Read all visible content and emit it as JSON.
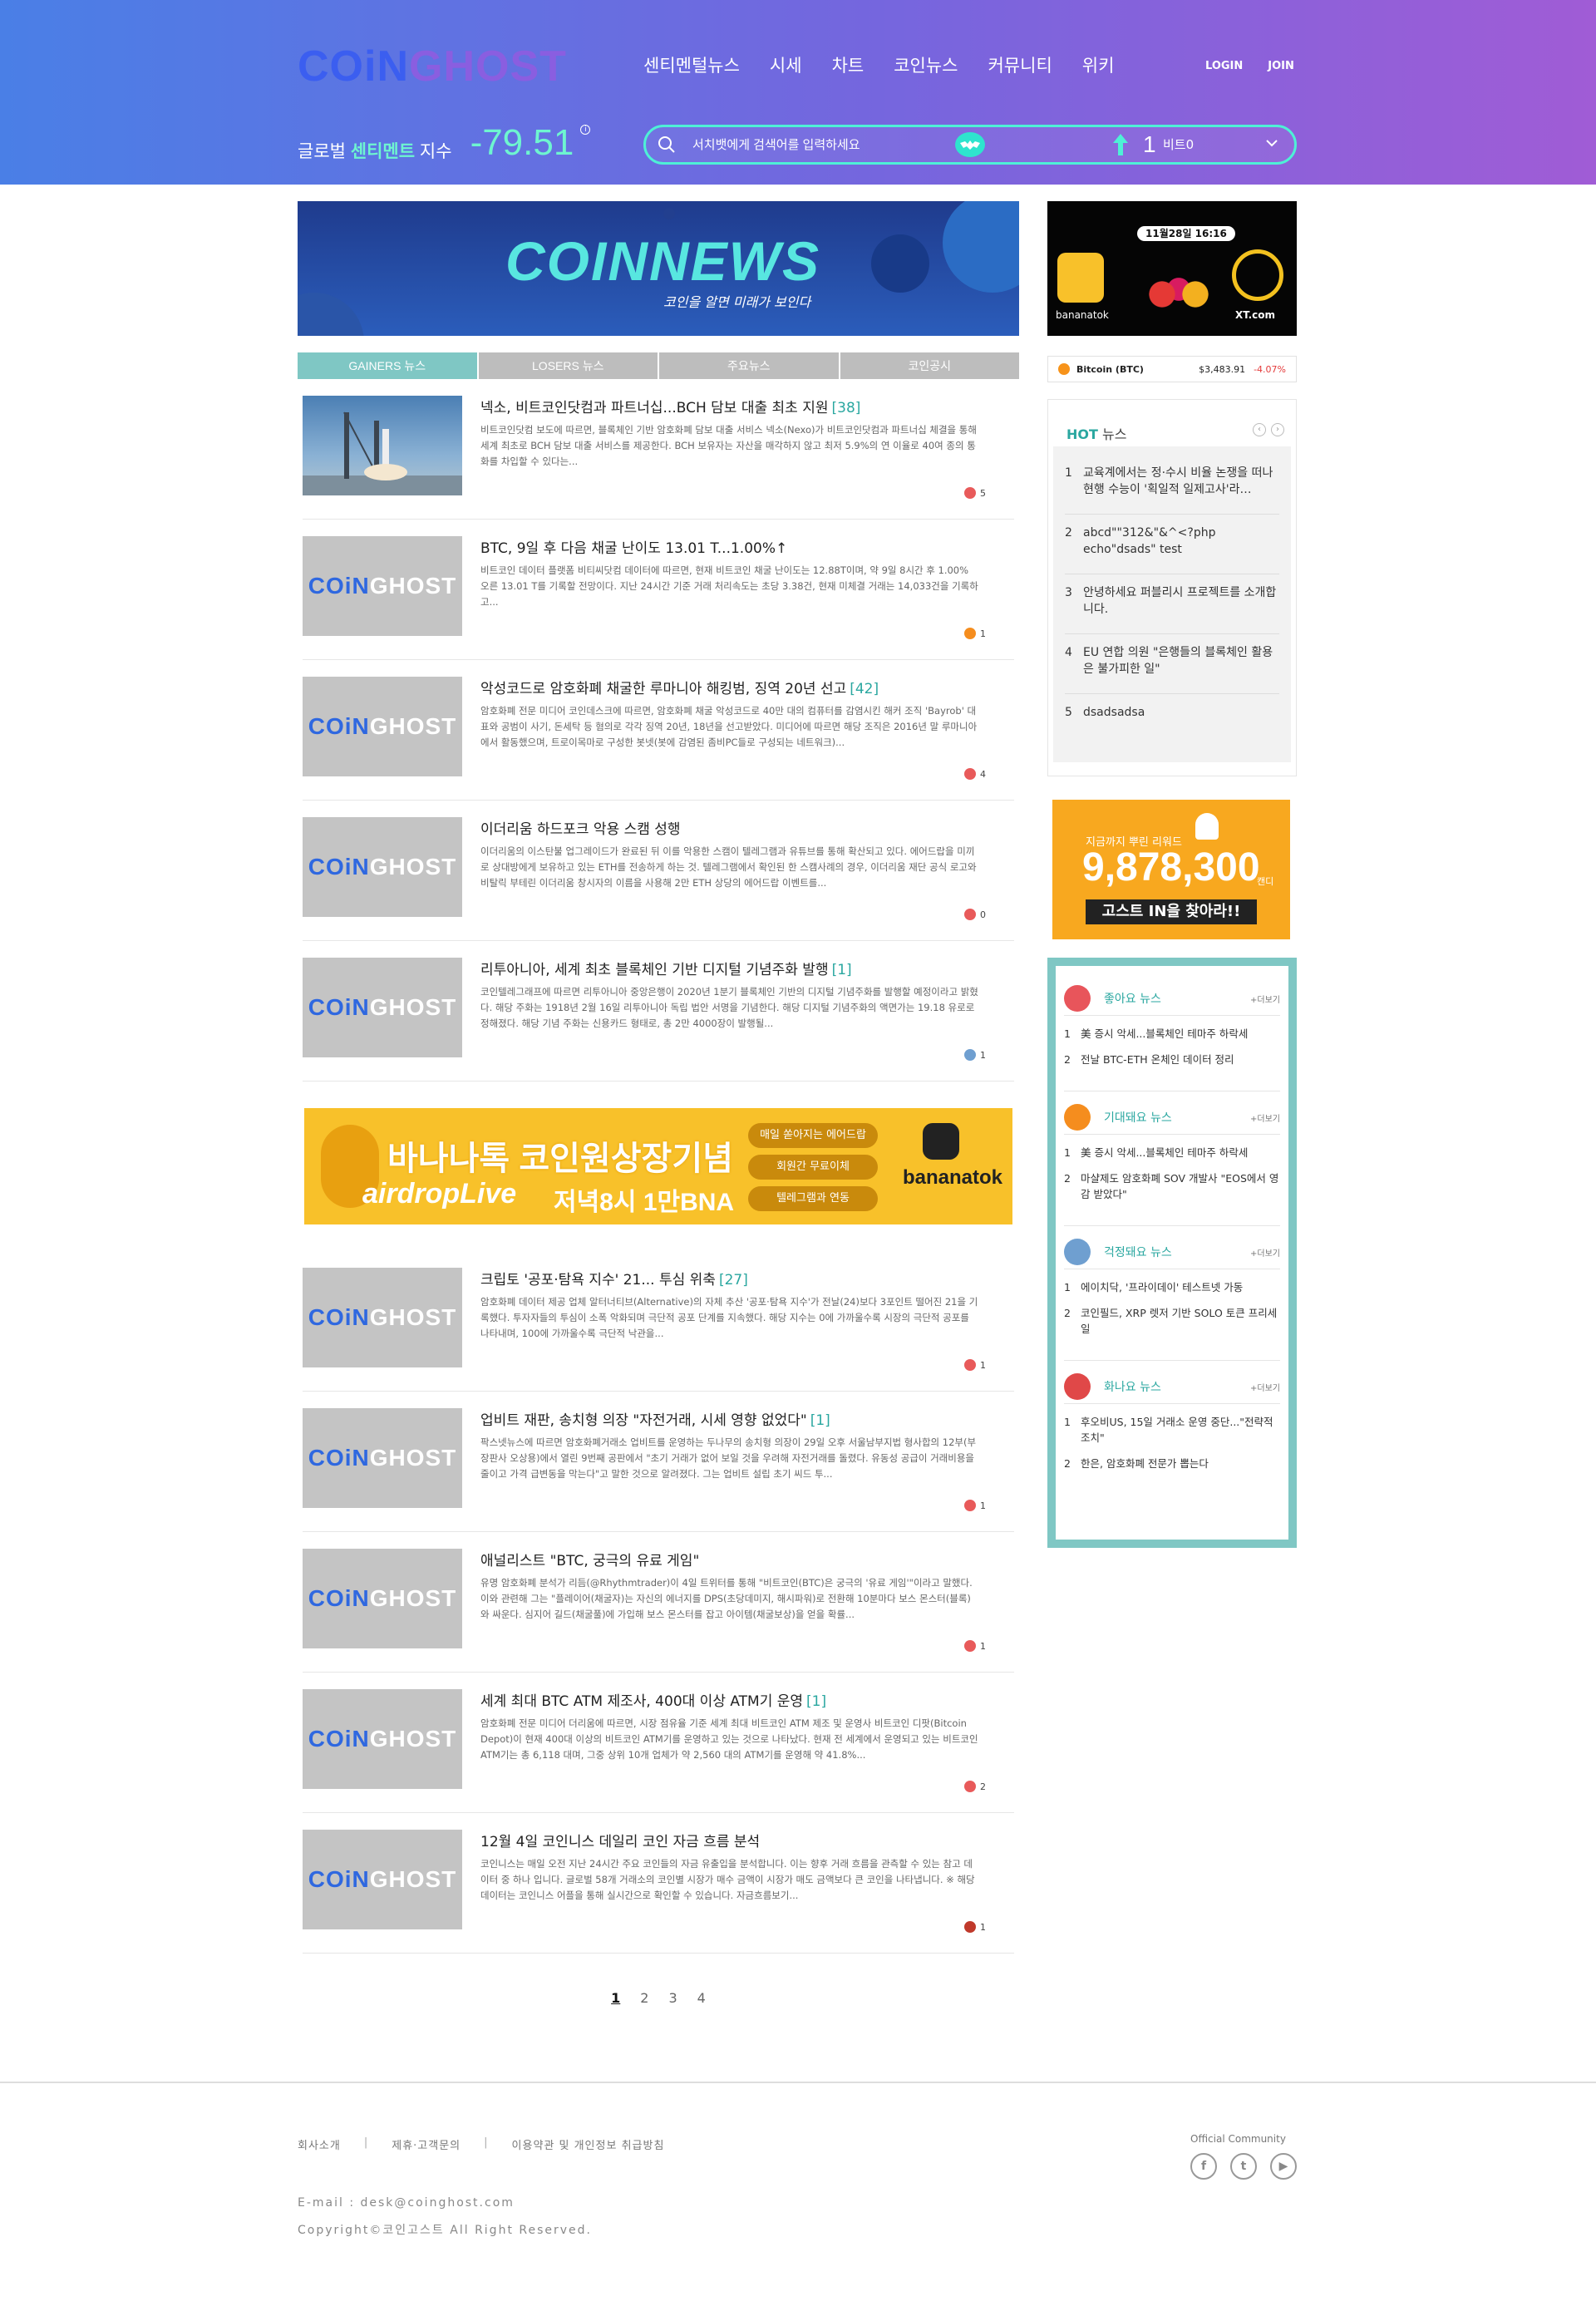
{
  "header": {
    "logo_left": "COiN",
    "logo_right": "GHOST",
    "nav": [
      "센티멘털뉴스",
      "시세",
      "차트",
      "코인뉴스",
      "커뮤니티",
      "위키"
    ],
    "login": "LOGIN",
    "join": "JOIN",
    "sentiment_label_pre": "글로벌 ",
    "sentiment_label_em": "센티멘트",
    "sentiment_label_post": " 지수",
    "sentiment_value": "-79.51",
    "search_placeholder": "서치뱃에게 검색어를 입력하세요",
    "user_count": "1",
    "user_label": "비트0"
  },
  "banner": {
    "title": "COINNEWS",
    "subtitle": "코인을 알면 미래가 보인다"
  },
  "tabs": [
    "GAINERS 뉴스",
    "LOSERS 뉴스",
    "주요뉴스",
    "코인공시"
  ],
  "articles": [
    {
      "title": "넥소, 비트코인닷컴과 파트너십...BCH 담보 대출 최초 지원",
      "count": "[38]",
      "summary": "비트코인닷컴 보도에 따르면, 블록체인 기반 암호화폐 담보 대출 서비스 넥소(Nexo)가 비트코인닷컴과 파트너십 체결을 통해 세계 최초로 BCH 담보 대출 서비스를 제공한다. BCH 보유자는 자산을 매각하지 않고 최저 5.9%의 연 이율로 40여 종의 통화를 차입할 수 있다는...",
      "reactions": "5"
    },
    {
      "title": "BTC, 9일 후 다음 채굴 난이도 13.01 T...1.00%↑",
      "count": "",
      "summary": "비트코인 데이터 플랫폼 비티씨닷컴 데이터에 따르면, 현재 비트코인 채굴 난이도는 12.88T이며, 약 9일 8시간 후 1.00% 오른 13.01 T를 기록할 전망이다. 지난 24시간 기준 거래 처리속도는 초당 3.38건, 현재 미체결 거래는 14,033건을 기록하고...",
      "reactions": "1"
    },
    {
      "title": "악성코드로 암호화폐 채굴한 루마니아 해킹범, 징역 20년 선고",
      "count": "[42]",
      "summary": "암호화폐 전문 미디어 코인데스크에 따르면, 암호화폐 채굴 악성코드로 40만 대의 컴퓨터를 감염시킨 해커 조직 'Bayrob' 대표와 공범이 사기, 돈세탁 등 혐의로 각각 징역 20년, 18년을 선고받았다. 미디어에 따르면 해당 조직은 2016년 말 루마니아에서 활동했으며, 트로이목마로 구성한 봇넷(봇에 감염된 좀비PC들로 구성되는 네트워크)...",
      "reactions": "4"
    },
    {
      "title": "이더리움 하드포크 악용 스캠 성행",
      "count": "",
      "summary": "이더리움의 이스탄불 업그레이드가 완료된 뒤 이를 악용한 스캠이 텔레그램과 유튜브를 통해 확산되고 있다. 에어드랍을 미끼로 상대방에게 보유하고 있는 ETH를 전송하게 하는 것. 텔레그램에서 확인된 한 스캠사례의 경우, 이더리움 재단 공식 로고와 비탈릭 부테린 이더리움 창시자의 이름을 사용해 2만 ETH 상당의 에어드랍 이벤트를...",
      "reactions": "0"
    },
    {
      "title": "리투아니아, 세계 최초 블록체인 기반 디지털 기념주화 발행",
      "count": "[1]",
      "summary": "코인텔레그래프에 따르면 리투아니아 중앙은행이 2020년 1분기 블록체인 기반의 디지털 기념주화를 발행할 예정이라고 밝혔다. 해당 주화는 1918년 2월 16일 리투아니아 독립 법안 서명을 기념한다. 해당 디지털 기념주화의 액면가는 19.18 유로로 정해졌다. 해당 기념 주화는 신용카드 형태로, 총 2만 4000장이 발행될...",
      "reactions": "1"
    },
    {
      "title": "크립토 '공포·탐욕 지수' 21... 투심 위축",
      "count": "[27]",
      "summary": "암호화폐 데이터 제공 업체 알터너티브(Alternative)의 자체 추산 '공포·탐욕 지수'가 전날(24)보다 3포인트 떨어진 21을 기록했다. 투자자들의 투심이 소폭 악화되며 극단적 공포 단계를 지속했다. 해당 지수는 0에 가까울수록 시장의 극단적 공포를 나타내며, 100에 가까울수록 극단적 낙관을...",
      "reactions": "1"
    },
    {
      "title": "업비트 재판, 송치형 의장 \"자전거래, 시세 영향 없었다\"",
      "count": "[1]",
      "summary": "팍스넷뉴스에 따르면 암호화폐거래소 업비트를 운영하는 두나무의 송치형 의장이 29일 오후 서울남부지법 형사합의 12부(부장판사 오상용)에서 열린 9번째 공판에서 \"초기 거래가 없어 보일 것을 우려해 자전거래를 돌렸다. 유동성 공급이 거래비용을 줄이고 가격 급변동을 막는다\"고 말한 것으로 알려졌다. 그는 업비트 설립 초기 씨드 투...",
      "reactions": "1"
    },
    {
      "title": "애널리스트 \"BTC, 궁극의 유료 게임\"",
      "count": "",
      "summary": "유명 암호화폐 분석가 리듬(@Rhythmtrader)이 4일 트위터를 통해 \"비트코인(BTC)은 궁극의 '유료 게임'\"이라고 말했다. 이와 관련해 그는 \"플레이어(채굴자)는 자신의 에너지를 DPS(초당데미지, 해시파워)로 전환해 10분마다 보스 몬스터(블록)와 싸운다. 심지어 길드(채굴풀)에 가입해 보스 몬스터를 잡고 아이템(채굴보상)을 얻을 확률...",
      "reactions": "1"
    },
    {
      "title": "세계 최대 BTC ATM 제조사, 400대 이상 ATM기 운영",
      "count": "[1]",
      "summary": "암호화폐 전문 미디어 더리움에 따르면, 시장 점유율 기준 세계 최대 비트코인 ATM 제조 및 운영사 비트코인 디팟(Bitcoin Depot)이 현재 400대 이상의 비트코인 ATM기를 운영하고 있는 것으로 나타났다. 현재 전 세계에서 운영되고 있는 비트코인 ATM기는 총 6,118 대며, 그중 상위 10개 업체가 약 2,560 대의 ATM기를 운영해 약 41.8%...",
      "reactions": "2"
    },
    {
      "title": "12월 4일 코인니스 데일리 코인 자금 흐름 분석",
      "count": "",
      "summary": "코인니스는 매일 오전 지난 24시간 주요 코인들의 자금 유출입을 분석합니다. 이는 향후 거래 흐름을 관측할 수 있는 참고 데이터 중 하나 입니다. 글로벌 58개 거래소의 코인별 시장가 매수 금액이 시장가 매도 금액보다 큰 코인을 나타냅니다. ※ 해당 데이터는 코인니스 어플을 통해 실시간으로 확인할 수 있습니다. 자금흐름보기...",
      "reactions": "1"
    }
  ],
  "ad": {
    "headline": "바나나톡 코인원상장기념",
    "sub1": "airdropLive",
    "sub2": "저녁8시 1만BNA",
    "pills": [
      "매일 쏟아지는 에어드랍",
      "회원간 무료이체",
      "텔레그램과 연동"
    ],
    "brand": "bananatok"
  },
  "pagination": [
    "1",
    "2",
    "3",
    "4"
  ],
  "side_ad": {
    "date": "11월28일 16:16",
    "left_brand": "bananatok",
    "right_brand": "XT.com"
  },
  "ticker": {
    "name": "Bitcoin (BTC)",
    "price": "$3,483.91",
    "change": "-4.07%"
  },
  "hot": {
    "title_em": "HOT",
    "title_rest": " 뉴스",
    "items": [
      {
        "n": "1",
        "text": "교육계에서는 정·수시 비율 논쟁을 떠나 현행 수능이 '획일적 일제고사'라…"
      },
      {
        "n": "2",
        "text": "abcd\"\"312&\"&^<?php echo\"dsads\" test"
      },
      {
        "n": "3",
        "text": "안녕하세요 퍼블리시 프로젝트를 소개합니다."
      },
      {
        "n": "4",
        "text": "EU 연합 의원 \"은행들의 블록체인 활용은 불가피한 일\""
      },
      {
        "n": "5",
        "text": "dsadsadsa"
      }
    ]
  },
  "ghost": {
    "line1": "지금까지 뿌린 리워드",
    "amount": "9,878,300",
    "unit": "캔디",
    "button": "고스트 IN을 찾아라!!"
  },
  "emotions": [
    {
      "title": "좋아요 뉴스",
      "more": "+더보기",
      "color": "#e8555b",
      "items": [
        "美 증시 악세...블록체인 테마주 하락세",
        "전날 BTC-ETH 온체인 데이터 정리"
      ]
    },
    {
      "title": "기대돼요 뉴스",
      "more": "+더보기",
      "color": "#f58d1e",
      "items": [
        "美 증시 악세...블록체인 테마주 하락세",
        "마샬제도 암호화폐 SOV 개발사 \"EOS에서 영감 받았다\""
      ]
    },
    {
      "title": "걱정돼요 뉴스",
      "more": "+더보기",
      "color": "#6f9fd0",
      "items": [
        "에이치닥, '프라이데이' 테스트넷 가동",
        "코인필드, XRP 렛저 기반 SOLO 토큰 프리세일"
      ]
    },
    {
      "title": "화나요 뉴스",
      "more": "+더보기",
      "color": "#e04848",
      "items": [
        "후오비US, 15일 거래소 운영 중단...\"전략적 조치\"",
        "한은, 암호화폐 전문가 뽑는다"
      ]
    }
  ],
  "footer": {
    "links": [
      "회사소개",
      "제휴·고객문의",
      "이용약관 및 개인정보 취급방침"
    ],
    "community": "Official Community",
    "email": "E-mail : desk@coinghost.com",
    "copyright": "Copyright©코인고스트 All Right Reserved."
  }
}
